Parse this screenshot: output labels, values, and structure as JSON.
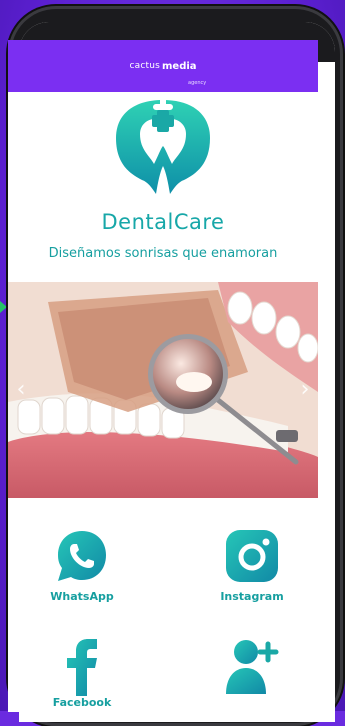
{
  "agency": {
    "logo_left": "cactus",
    "logo_right": "media",
    "logo_sub": "agency"
  },
  "brand": {
    "name": "DentalCare",
    "tagline": "Diseñamos sonrisas que enamoran"
  },
  "carousel": {
    "prev": "‹",
    "next": "›"
  },
  "social": {
    "whatsapp": "WhatsApp",
    "instagram": "Instagram",
    "facebook": "Facebook"
  },
  "colors": {
    "background": "#6a2be0",
    "topbar": "#7b2ff2",
    "brand_teal": "#17a7a8",
    "icon_gradient_start": "#26c6b7",
    "icon_gradient_end": "#1189a6"
  }
}
